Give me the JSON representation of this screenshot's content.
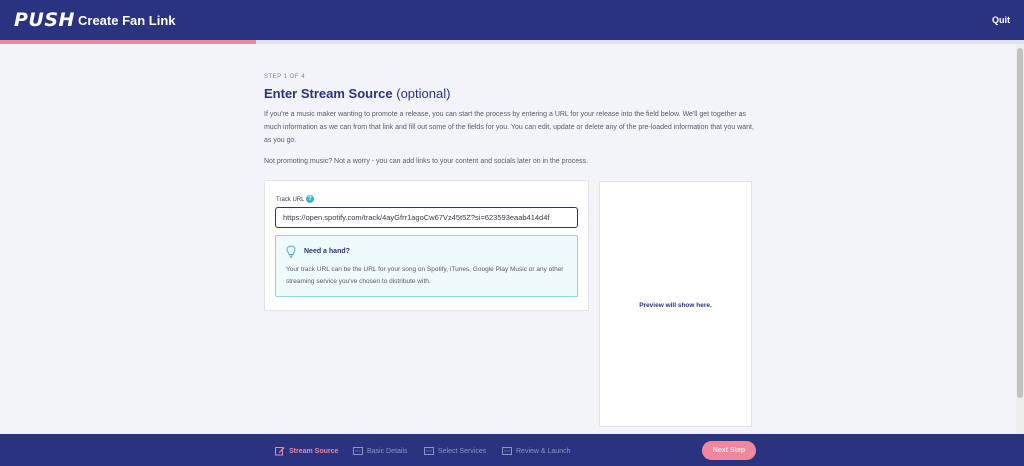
{
  "header": {
    "logo": "PUSH",
    "title": "Create Fan Link",
    "quit_label": "Quit"
  },
  "progress": {
    "value_percent": 25
  },
  "step": {
    "label": "STEP 1 OF 4",
    "title": "Enter Stream Source",
    "title_suffix": "(optional)",
    "intro": "If you're a music maker wanting to promote a release, you can start the process by entering a URL for your release into the field below. We'll get together as much information as we can from that link and fill out some of the fields for you. You can edit, update or delete any of the pre-loaded information that you want, as you go.",
    "intro2": "Not promoting music? Not a worry - you can add links to your content and socials later on in the process."
  },
  "form": {
    "track_url_label": "Track URL",
    "track_url_value": "https://open.spotify.com/track/4ayGfrr1agoCw67Vz45t5Z?si=623593eaab414d4f",
    "hint_title": "Need a hand?",
    "hint_text": "Your track URL can be the URL for your song on Spotify, iTunes, Google Play Music or any other streaming service you've chosen to distribute with."
  },
  "preview": {
    "placeholder": "Preview will show here."
  },
  "footer": {
    "steps": [
      {
        "label": "Stream Source",
        "active": true
      },
      {
        "label": "Basic Details",
        "active": false
      },
      {
        "label": "Select Services",
        "active": false
      },
      {
        "label": "Review & Launch",
        "active": false
      }
    ],
    "next_label": "Next Step"
  },
  "colors": {
    "primary": "#2a3380",
    "accent": "#f0879e",
    "info": "#3fb4c9"
  }
}
